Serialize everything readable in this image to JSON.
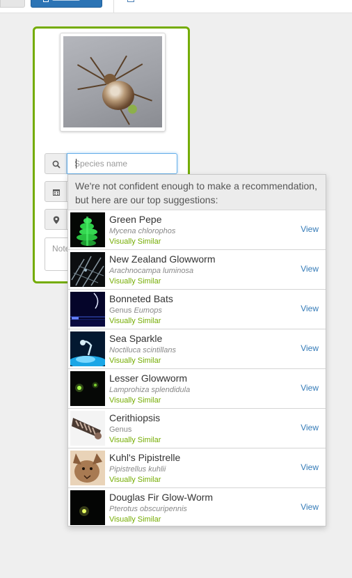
{
  "search": {
    "placeholder": "Species name"
  },
  "notes": {
    "placeholder": "Note"
  },
  "suggestions": {
    "header": "We're not confident enough to make a recommendation, but here are our top suggestions:",
    "view_label": "View",
    "items": [
      {
        "name": "Green Pepe",
        "sci_prefix": "",
        "sci": "Mycena chlorophos",
        "tag": "Visually Similar"
      },
      {
        "name": "New Zealand Glowworm",
        "sci_prefix": "",
        "sci": "Arachnocampa luminosa",
        "tag": "Visually Similar"
      },
      {
        "name": "Bonneted Bats",
        "sci_prefix": "Genus ",
        "sci": "Eumops",
        "tag": "Visually Similar"
      },
      {
        "name": "Sea Sparkle",
        "sci_prefix": "",
        "sci": "Noctiluca scintillans",
        "tag": "Visually Similar"
      },
      {
        "name": "Lesser Glowworm",
        "sci_prefix": "",
        "sci": "Lamprohiza splendidula",
        "tag": "Visually Similar"
      },
      {
        "name": "Cerithiopsis",
        "sci_prefix": "Genus",
        "sci": "",
        "tag": "Visually Similar"
      },
      {
        "name": "Kuhl's Pipistrelle",
        "sci_prefix": "",
        "sci": "Pipistrellus kuhlii",
        "tag": "Visually Similar"
      },
      {
        "name": "Douglas Fir Glow-Worm",
        "sci_prefix": "",
        "sci": "Pterotus obscuripennis",
        "tag": "Visually Similar"
      }
    ]
  },
  "colors": {
    "accent_green": "#74ac00",
    "link_blue": "#337ab7",
    "top_blue": "#2c74b5"
  },
  "icons": [
    "search-icon",
    "calendar-icon",
    "map-marker-icon",
    "upload-icon",
    "list-icon"
  ]
}
